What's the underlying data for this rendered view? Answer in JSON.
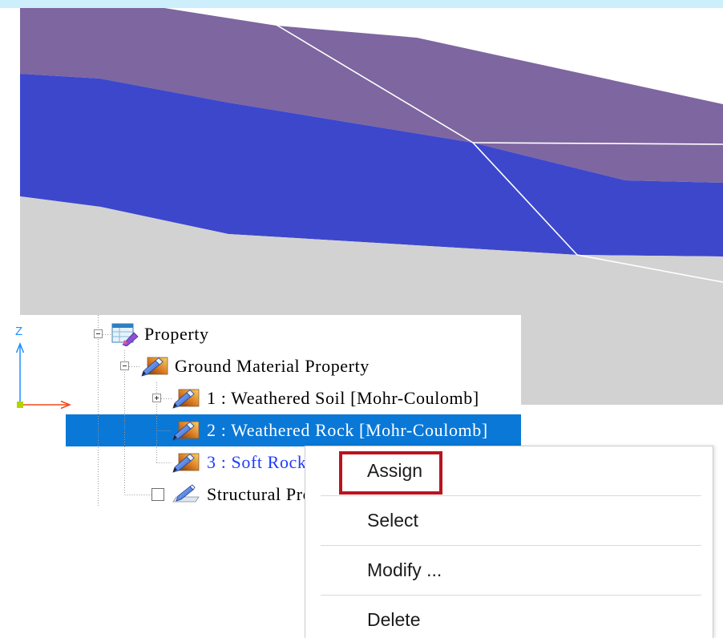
{
  "colors": {
    "frame_strip": "#cdeffc",
    "layer_purple": "#7e66a0",
    "layer_blue": "#3d47cc",
    "layer_gray": "#d2d2d2",
    "boundary_line": "#ffffff",
    "selection": "#0a78d7",
    "highlight_box": "#b9141f",
    "item_text_blue": "#1d3cff",
    "z_axis": "#1e8fff",
    "x_axis": "#f04a1c",
    "origin_marker": "#b4d400"
  },
  "axis": {
    "z_label": "Z"
  },
  "tree": {
    "items": [
      {
        "label": "Property",
        "icon": "property-icon",
        "toggle_icon": "collapse-toggle-icon"
      },
      {
        "label": "Ground Material Property",
        "icon": "ground-material-icon",
        "toggle_icon": "collapse-toggle-icon"
      },
      {
        "label": "1 : Weathered Soil [Mohr-Coulomb]",
        "icon": "material-icon",
        "toggle_icon": "expand-toggle-icon"
      },
      {
        "label": "2 : Weathered Rock [Mohr-Coulomb]",
        "icon": "material-icon",
        "selected": true
      },
      {
        "label": "3 : Soft Rock",
        "icon": "material-icon"
      },
      {
        "label": "Structural Pro",
        "icon": "structural-property-icon",
        "checkbox_checked": false
      }
    ]
  },
  "context_menu": {
    "items": [
      {
        "label": "Assign",
        "highlighted": true
      },
      {
        "label": "Select"
      },
      {
        "label": "Modify ..."
      },
      {
        "label": "Delete"
      }
    ]
  }
}
